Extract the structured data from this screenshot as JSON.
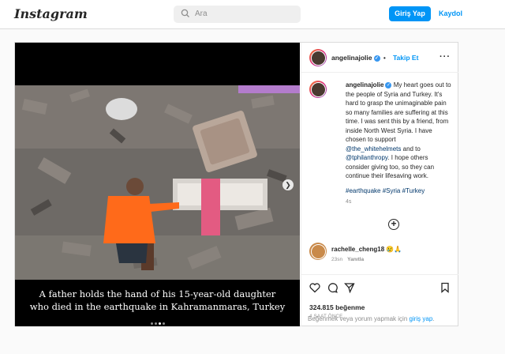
{
  "header": {
    "logo": "Instagram",
    "search_placeholder": "Ara",
    "login_button": "Giriş Yap",
    "signup_link": "Kaydol"
  },
  "post": {
    "image_caption_line1": "A father holds the hand of his 15-year-old daughter",
    "image_caption_line2": "who died in the earthquake in Kahramanmaras, Turkey",
    "carousel": {
      "count": 4,
      "active_index": 2
    },
    "author": "angelinajolie",
    "follow_label": "Takip Et",
    "dot_separator": "•",
    "caption_body": "My heart goes out to the people of Syria and Turkey. It's hard to grasp the unimaginable pain so many families are suffering at this time. I was sent this by a friend, from inside North West Syria. I have chosen to support ",
    "mention1": "@the_whitehelmets",
    "caption_mid": " and to ",
    "mention2": "@tphilanthropy",
    "caption_end": ". I hope others consider giving too, so they can continue their lifesaving work.",
    "hashtags": "#earthquake #Syria #Turkey",
    "caption_time": "4s",
    "comment": {
      "user": "rachelle_cheng18",
      "text": "😢🙏",
      "time": "23sn",
      "reply": "Yanıtla"
    },
    "likes": "324.815 beğenme",
    "posted_ago": "4 SAAT ÖNCE",
    "login_prompt_prefix": "Beğenmek veya yorum yapmak için ",
    "login_prompt_link": "giriş yap",
    "login_prompt_suffix": "."
  },
  "colors": {
    "accent": "#0095f6",
    "border": "#dbdbdb",
    "secondary_text": "#8e8e8e"
  }
}
